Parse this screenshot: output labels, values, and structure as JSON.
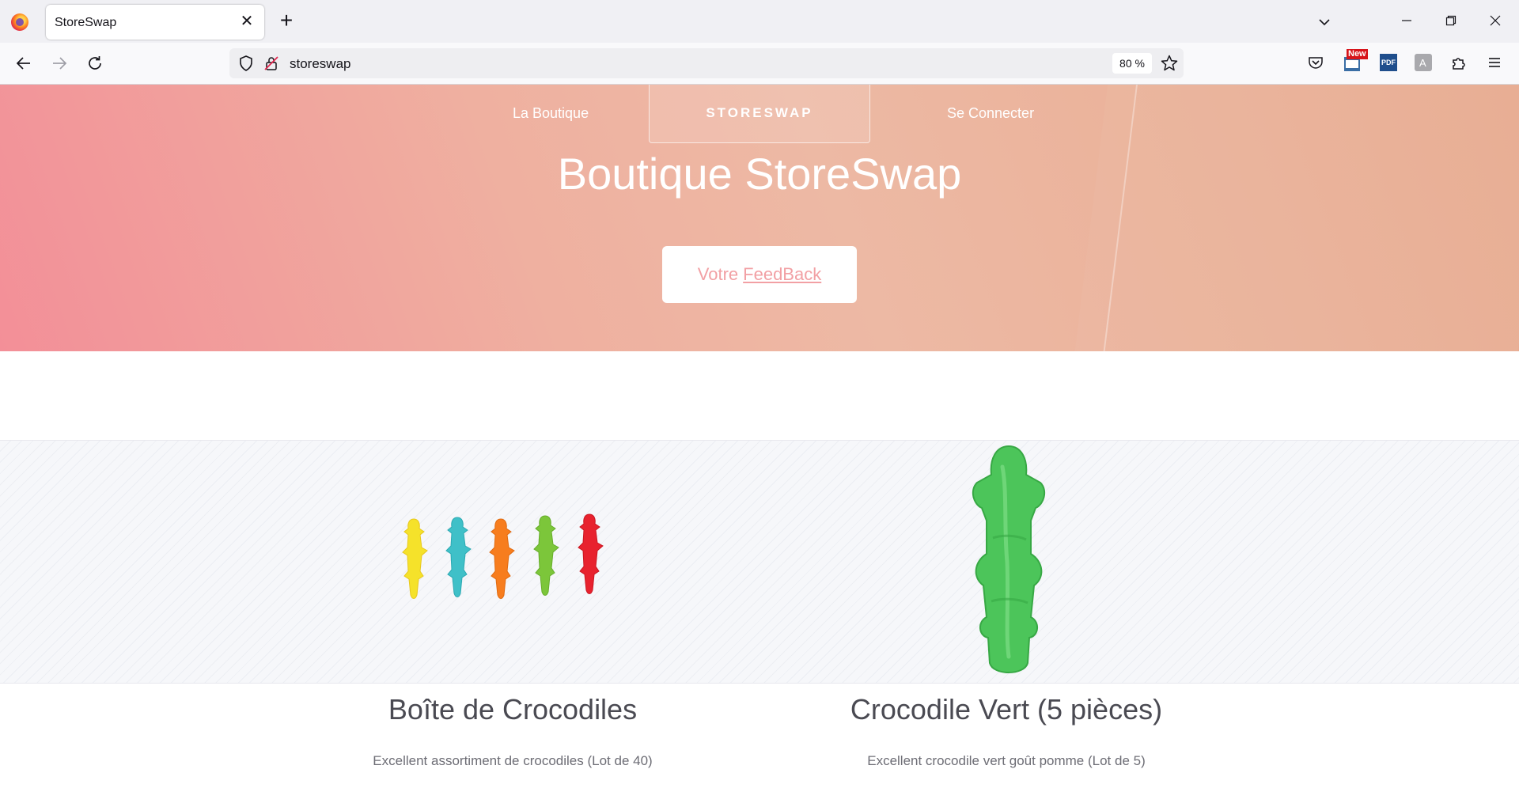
{
  "browser": {
    "tab_title": "StoreSwap",
    "url": "storeswap",
    "zoom": "80 %",
    "ext_badge": "New",
    "ext_pdf": "PDF"
  },
  "nav": {
    "shop": "La Boutique",
    "brand": "STORESWAP",
    "login": "Se Connecter"
  },
  "hero": {
    "title": "Boutique StoreSwap",
    "feedback_prefix": "Votre",
    "feedback_link": "FeedBack"
  },
  "products": [
    {
      "title": "Boîte de Crocodiles",
      "description": "Excellent assortiment de crocodiles (Lot de 40)"
    },
    {
      "title": "Crocodile Vert (5 pièces)",
      "description": "Excellent crocodile vert goût pomme (Lot de 5)"
    }
  ],
  "colors": {
    "hero_start": "#f38f98",
    "hero_end": "#e8ab90",
    "feedback_text": "#f2a0a4",
    "croc_yellow": "#f5e22a",
    "croc_teal": "#3fc0c8",
    "croc_orange": "#f77d1e",
    "croc_green": "#7cc63a",
    "croc_red": "#e8222e",
    "croc_big_green": "#4cc55a"
  }
}
